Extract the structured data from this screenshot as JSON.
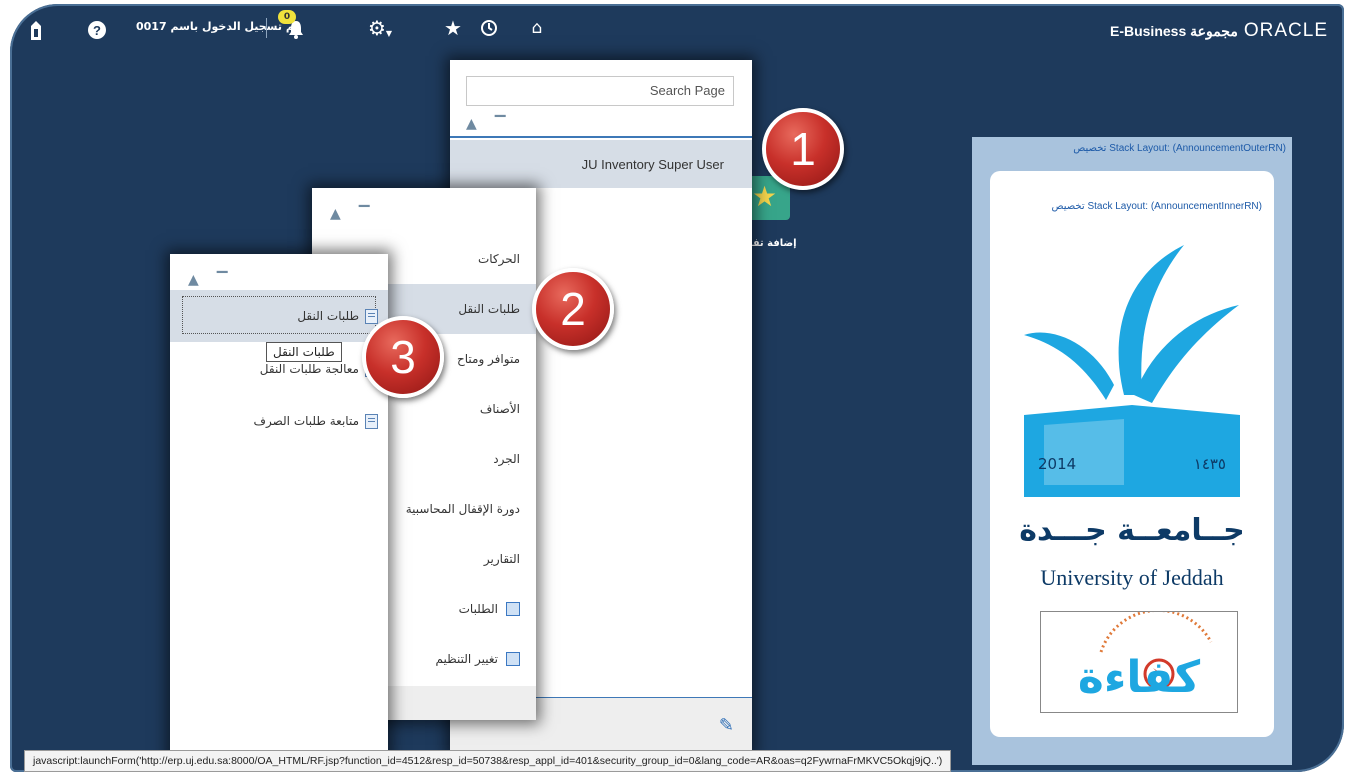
{
  "header": {
    "oracle": "ORACLE",
    "ebusiness": "E-Business مجموعة",
    "logged_in_as": "0017 تم تسجيل الدخول باسم",
    "notification_count": "0"
  },
  "responsibility_panel": {
    "search_placeholder": "Search Page",
    "selected_responsibility": "JU Inventory Super User"
  },
  "menu_panel": {
    "items": [
      "الحركات",
      "طلبات النقل",
      "متوافر ومتاح",
      "الأصناف",
      "الجرد",
      "دورة الإقفال المحاسبية",
      "التقارير",
      "الطلبات",
      "تغيير التنظيم"
    ]
  },
  "submenu_panel": {
    "items": [
      "طلبات النقل",
      "معالجة طلبات النقل",
      "متابعة طلبات الصرف"
    ],
    "tooltip": "طلبات النقل"
  },
  "add_favorite_label": "إضافة تف",
  "badges": [
    "1",
    "2",
    "3"
  ],
  "announcement": {
    "outer_label": "تخصيص Stack Layout: (AnnouncementOuterRN)",
    "inner_label": "تخصيص Stack Layout: (AnnouncementInnerRN)",
    "year_gregorian": "2014",
    "year_hijri": "١٤٣٥",
    "university_ar": "جــامعــة جـــدة",
    "university_en": "University of Jeddah",
    "kafaa_logo_text": "كفاءة"
  },
  "status_bar": "javascript:launchForm('http://erp.uj.edu.sa:8000/OA_HTML/RF.jsp?function_id=4512&resp_id=50738&resp_appl_id=401&security_group_id=0&lang_code=AR&oas=q2FywrnaFrMKVC5Okqj9jQ..')",
  "colors": {
    "background": "#1e3a5c",
    "badge": "#c8302a",
    "announcement_outer": "#a9c3dd",
    "logo_blue": "#1ea7e1"
  }
}
